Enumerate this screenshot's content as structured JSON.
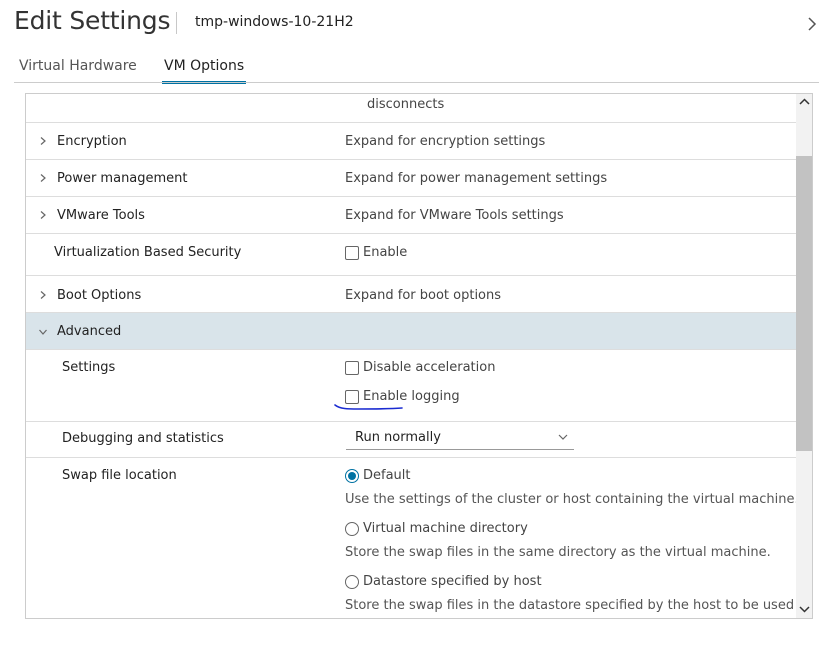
{
  "header": {
    "title": "Edit Settings",
    "vm_name": "tmp-windows-10-21H2"
  },
  "tabs": [
    {
      "label": "Virtual Hardware",
      "active": false
    },
    {
      "label": "VM Options",
      "active": true
    }
  ],
  "rows": {
    "disconnects": "disconnects",
    "encryption": {
      "label": "Encryption",
      "value": "Expand for encryption settings"
    },
    "power": {
      "label": "Power management",
      "value": "Expand for power management settings"
    },
    "vmtools": {
      "label": "VMware Tools",
      "value": "Expand for VMware Tools settings"
    },
    "vbs": {
      "label": "Virtualization Based Security",
      "checkbox_label": "Enable",
      "checked": false
    },
    "boot": {
      "label": "Boot Options",
      "value": "Expand for boot options"
    },
    "advanced": {
      "label": "Advanced"
    },
    "settings": {
      "label": "Settings",
      "disable_acceleration": "Disable acceleration",
      "enable_logging": "Enable logging"
    },
    "debugging": {
      "label": "Debugging and statistics",
      "selected": "Run normally"
    },
    "swap": {
      "label": "Swap file location",
      "options": [
        {
          "label": "Default",
          "checked": true,
          "desc": "Use the settings of the cluster or host containing the virtual machine."
        },
        {
          "label": "Virtual machine directory",
          "checked": false,
          "desc": "Store the swap files in the same directory as the virtual machine."
        },
        {
          "label": "Datastore specified by host",
          "checked": false,
          "desc": "Store the swap files in the datastore specified by the host to be used"
        }
      ]
    }
  },
  "colors": {
    "accent": "#0072a3",
    "selected_row": "#d9e4ea",
    "annotation": "#1a2bd1"
  }
}
